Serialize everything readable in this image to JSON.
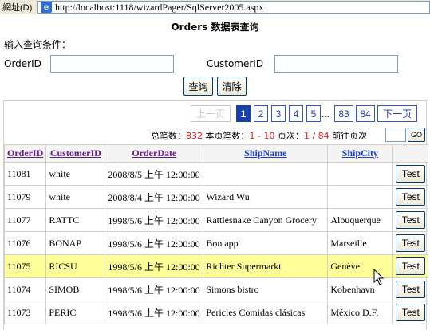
{
  "address_bar": {
    "label": "網址(D)",
    "url": "http://localhost:1118/wizardPager/SqlServer2005.aspx"
  },
  "page": {
    "title": "Orders 数据表查询",
    "condition_label": "输入查询条件："
  },
  "filters": {
    "order_id_label": "OrderID",
    "order_id_value": "",
    "customer_id_label": "CustomerID",
    "customer_id_value": ""
  },
  "buttons": {
    "query": "查询",
    "clear": "清除",
    "go": "GO",
    "row_action": "Test"
  },
  "pager": {
    "prev": "上一页",
    "next": "下一页",
    "pages": [
      "1",
      "2",
      "3",
      "4",
      "5"
    ],
    "ellipsis": "...",
    "last_pages": [
      "83",
      "84"
    ],
    "current_page": "1"
  },
  "info": {
    "total_label": "总笔数：",
    "total": "832",
    "range_label": "本页笔数：",
    "range": "1 - 10",
    "page_label": "页次：",
    "page": "1 / 84",
    "goto_label": "前往页次"
  },
  "grid": {
    "columns": [
      "OrderID",
      "CustomerID",
      "OrderDate",
      "ShipName",
      "ShipCity"
    ],
    "rows": [
      {
        "order_id": "11081",
        "customer_id": "white",
        "order_date": "2008/8/5 上午 12:00:00",
        "ship_name": "",
        "ship_city": ""
      },
      {
        "order_id": "11079",
        "customer_id": "white",
        "order_date": "2008/8/4 上午 12:00:00",
        "ship_name": "Wizard Wu",
        "ship_city": ""
      },
      {
        "order_id": "11077",
        "customer_id": "RATTC",
        "order_date": "1998/5/6 上午 12:00:00",
        "ship_name": "Rattlesnake Canyon Grocery",
        "ship_city": "Albuquerque"
      },
      {
        "order_id": "11076",
        "customer_id": "BONAP",
        "order_date": "1998/5/6 上午 12:00:00",
        "ship_name": "Bon app'",
        "ship_city": "Marseille"
      },
      {
        "order_id": "11075",
        "customer_id": "RICSU",
        "order_date": "1998/5/6 上午 12:00:00",
        "ship_name": "Richter Supermarkt",
        "ship_city": "Genève",
        "selected": true
      },
      {
        "order_id": "11074",
        "customer_id": "SIMOB",
        "order_date": "1998/5/6 上午 12:00:00",
        "ship_name": "Simons bistro",
        "ship_city": "Kobenhavn"
      },
      {
        "order_id": "11073",
        "customer_id": "PERIC",
        "order_date": "1998/5/6 上午 12:00:00",
        "ship_name": "Pericles Comidas clásicas",
        "ship_city": "México D.F."
      }
    ],
    "selected_row_color": "#ffff99"
  }
}
